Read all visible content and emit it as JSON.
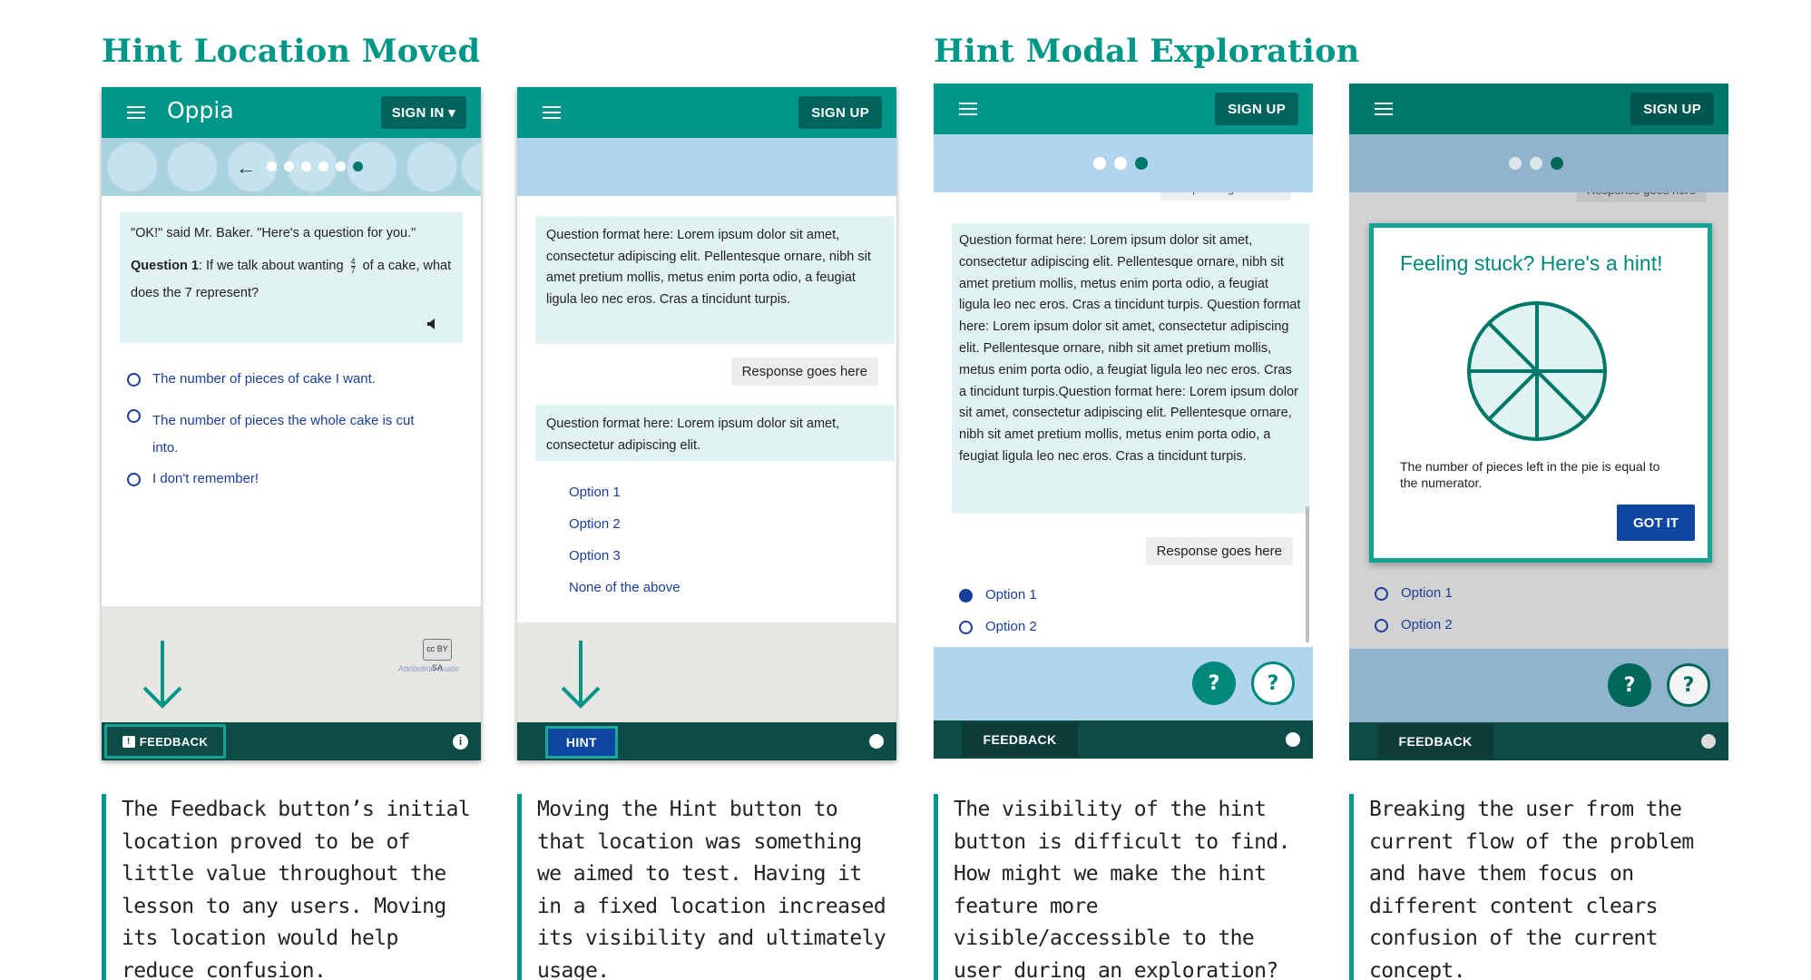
{
  "sections": {
    "left_title": "Hint Location Moved",
    "right_title": "Hint Modal Exploration"
  },
  "phone1": {
    "logo": "Oppia",
    "sign_in": "SIGN IN ▾",
    "back_icon": "arrow-left-icon",
    "question_intro": "\"OK!\" said Mr. Baker. \"Here's a question for you.\"",
    "question_label": "Question 1",
    "question_text_a": ": If we talk about wanting",
    "fraction_num": "4",
    "fraction_den": "7",
    "question_text_b": "of a cake, what does the 7 represent?",
    "audio_icon": "speaker-icon",
    "options": [
      "The number of pieces of cake I want.",
      "The number of pieces the whole cake is cut into.",
      "I don't remember!"
    ],
    "attribution": "Attribution Guide",
    "license_badge": "cc BY SA",
    "footer_button": "FEEDBACK",
    "info_icon": "info-icon",
    "arrow_icon": "arrow-down-icon"
  },
  "phone2": {
    "sign_up": "SIGN UP",
    "card1": "Question format here: Lorem ipsum dolor sit amet, consectetur adipiscing elit. Pellentesque ornare, nibh sit amet pretium mollis, metus enim porta odio, a feugiat ligula leo nec eros. Cras a tincidunt turpis.",
    "response": "Response goes here",
    "card2": "Question format here: Lorem ipsum dolor sit amet, consectetur adipiscing elit.",
    "options": [
      "Option 1",
      "Option 2",
      "Option 3",
      "None of the above"
    ],
    "footer_button": "HINT",
    "arrow_icon": "arrow-down-icon"
  },
  "phone3": {
    "sign_up": "SIGN UP",
    "peek_text": "Response goes here",
    "card": "Question format here: Lorem ipsum dolor sit amet, consectetur adipiscing elit. Pellentesque ornare, nibh sit amet pretium mollis, metus enim porta odio, a feugiat ligula leo nec eros. Cras a tincidunt turpis. Question format here: Lorem ipsum dolor sit amet, consectetur adipiscing elit. Pellentesque ornare, nibh sit amet pretium mollis, metus enim porta odio, a feugiat ligula leo nec eros. Cras a tincidunt turpis.Question format here: Lorem ipsum dolor sit amet, consectetur adipiscing elit. Pellentesque ornare, nibh sit amet pretium mollis, metus enim porta odio, a feugiat ligula leo nec eros. Cras a tincidunt turpis.",
    "response": "Response goes here",
    "options": [
      "Option 1",
      "Option 2"
    ],
    "hint_button": "?",
    "help_button": "?",
    "footer_button": "FEEDBACK"
  },
  "phone4": {
    "sign_up": "SIGN UP",
    "peek_text": "Response goes here",
    "modal_title": "Feeling stuck? Here's a hint!",
    "modal_text": "The number of pieces left in the pie is equal to the numerator.",
    "got_it": "GOT IT",
    "options": [
      "Option 1",
      "Option 2"
    ],
    "hint_button": "?",
    "help_button": "?",
    "footer_button": "FEEDBACK",
    "pie_icon": "pie-chart-icon"
  },
  "captions": [
    "The Feedback button’s initial location proved to be of little value throughout the lesson to any users. Moving its location would help reduce confusion.",
    "Moving the Hint button to that location was something we aimed to test. Having it in a fixed location increased its visibility and ultimately usage.",
    "The visibility of the hint button is difficult to find. How might we make the hint feature more visible/accessible to the user during an exploration?",
    "Breaking the user from the current flow of the problem and have them focus on different content clears confusion of the current concept."
  ],
  "colors": {
    "teal": "#009688",
    "dark_teal": "#0d4b46",
    "progress_blue": "#b2d5ee",
    "card_bg": "#e0f2f1",
    "option_blue": "#1a3e99",
    "got_it_blue": "#0d47a1"
  }
}
